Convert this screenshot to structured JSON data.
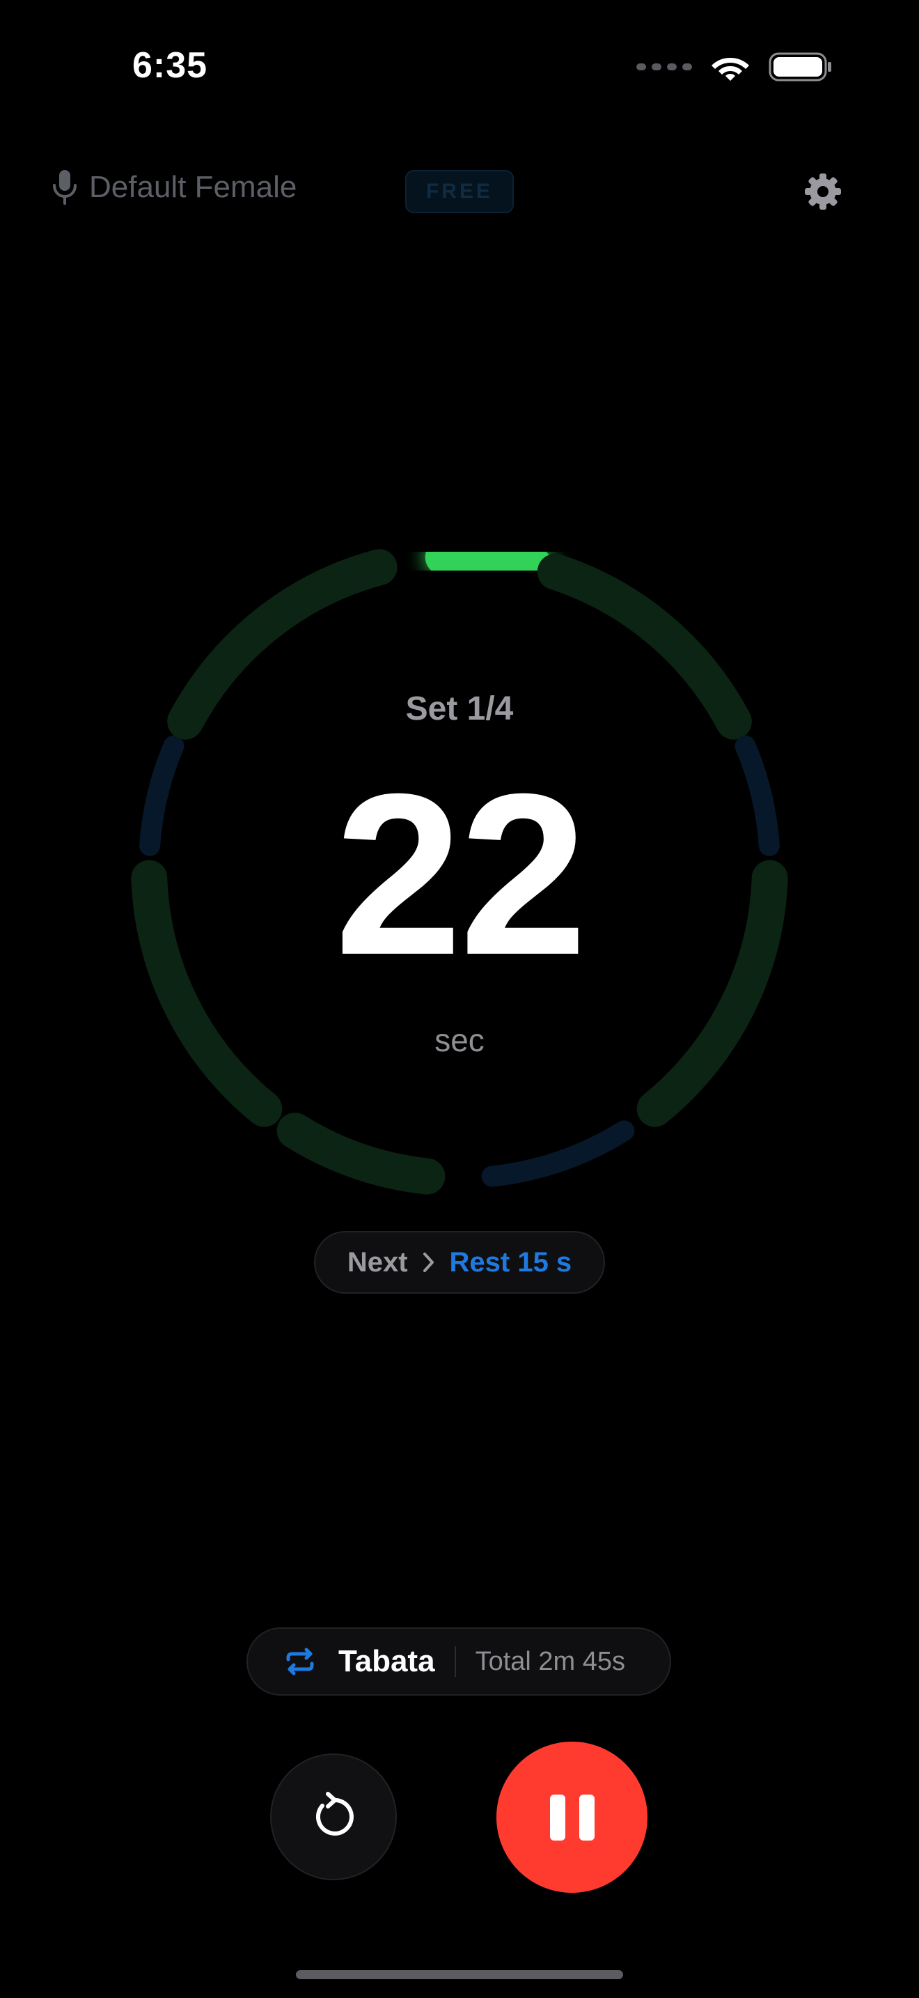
{
  "status_bar": {
    "time": "6:35",
    "icons": [
      "signal-dots-icon",
      "wifi-icon",
      "battery-icon"
    ]
  },
  "header": {
    "voice_icon": "microphone-icon",
    "voice_label": "Default Female",
    "badge": "FREE",
    "settings_icon": "gear-icon"
  },
  "timer": {
    "set_label": "Set 1/4",
    "count": "22",
    "unit": "sec",
    "segments": [
      {
        "phase": "work",
        "state": "active",
        "progress": 1.0
      },
      {
        "phase": "work",
        "state": "pending"
      },
      {
        "phase": "rest",
        "state": "pending"
      },
      {
        "phase": "work",
        "state": "pending"
      },
      {
        "phase": "rest",
        "state": "pending"
      },
      {
        "phase": "work",
        "state": "pending"
      },
      {
        "phase": "rest",
        "state": "pending"
      },
      {
        "phase": "work",
        "state": "pending"
      }
    ],
    "colors": {
      "work_active": "#30d158",
      "work_pending": "#0c2414",
      "rest_pending": "#06182a"
    }
  },
  "next": {
    "label": "Next",
    "chevron_icon": "chevron-right-icon",
    "value": "Rest 15 s"
  },
  "mode": {
    "icon": "repeat-icon",
    "name": "Tabata",
    "total": "Total 2m 45s"
  },
  "controls": {
    "restart_icon": "restart-icon",
    "pause_icon": "pause-icon",
    "pause_color": "#ff3b30",
    "accent_color": "#1f7ae0"
  }
}
